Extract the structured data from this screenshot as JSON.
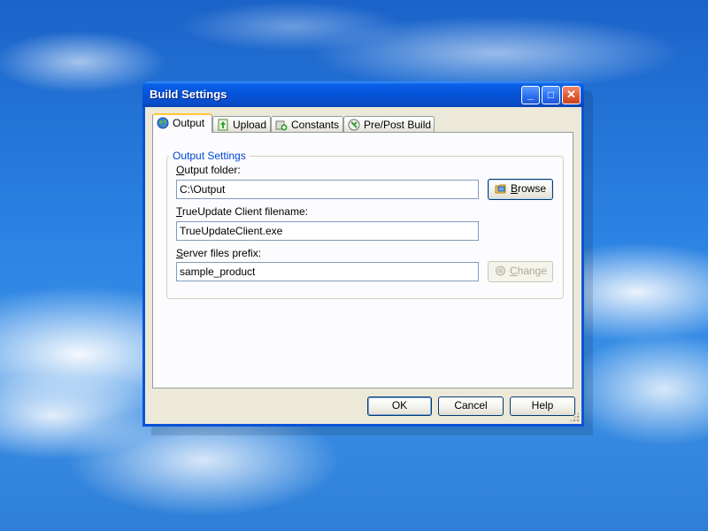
{
  "window": {
    "title": "Build Settings"
  },
  "titlebar_buttons": {
    "minimize": "_",
    "maximize": "□",
    "close": "✕"
  },
  "tabs": [
    {
      "label": "Output",
      "icon": "globe-icon",
      "active": true
    },
    {
      "label": "Upload",
      "icon": "upload-icon",
      "active": false
    },
    {
      "label": "Constants",
      "icon": "constants-icon",
      "active": false
    },
    {
      "label": "Pre/Post Build",
      "icon": "prepost-build-icon",
      "active": false
    }
  ],
  "output_settings": {
    "group_title": "Output Settings",
    "output_folder": {
      "label_accel": "O",
      "label_rest": "utput folder:",
      "value": "C:\\Output"
    },
    "client_filename": {
      "label_accel": "T",
      "label_rest": "rueUpdate Client filename:",
      "value": "TrueUpdateClient.exe"
    },
    "server_prefix": {
      "label_accel": "S",
      "label_rest": "erver files prefix:",
      "value": "sample_product"
    },
    "browse_button": {
      "accel": "B",
      "rest": "rowse",
      "icon": "folder-browse-icon"
    },
    "change_button": {
      "accel": "C",
      "rest": "hange",
      "icon": "change-icon",
      "enabled": false
    }
  },
  "footer": {
    "ok": "OK",
    "cancel": "Cancel",
    "help": "Help"
  },
  "colors": {
    "titlebar": "#0553d7",
    "client_bg": "#ece9d8",
    "group_title": "#0046d5",
    "active_tab_highlight": "#ffc73c"
  }
}
